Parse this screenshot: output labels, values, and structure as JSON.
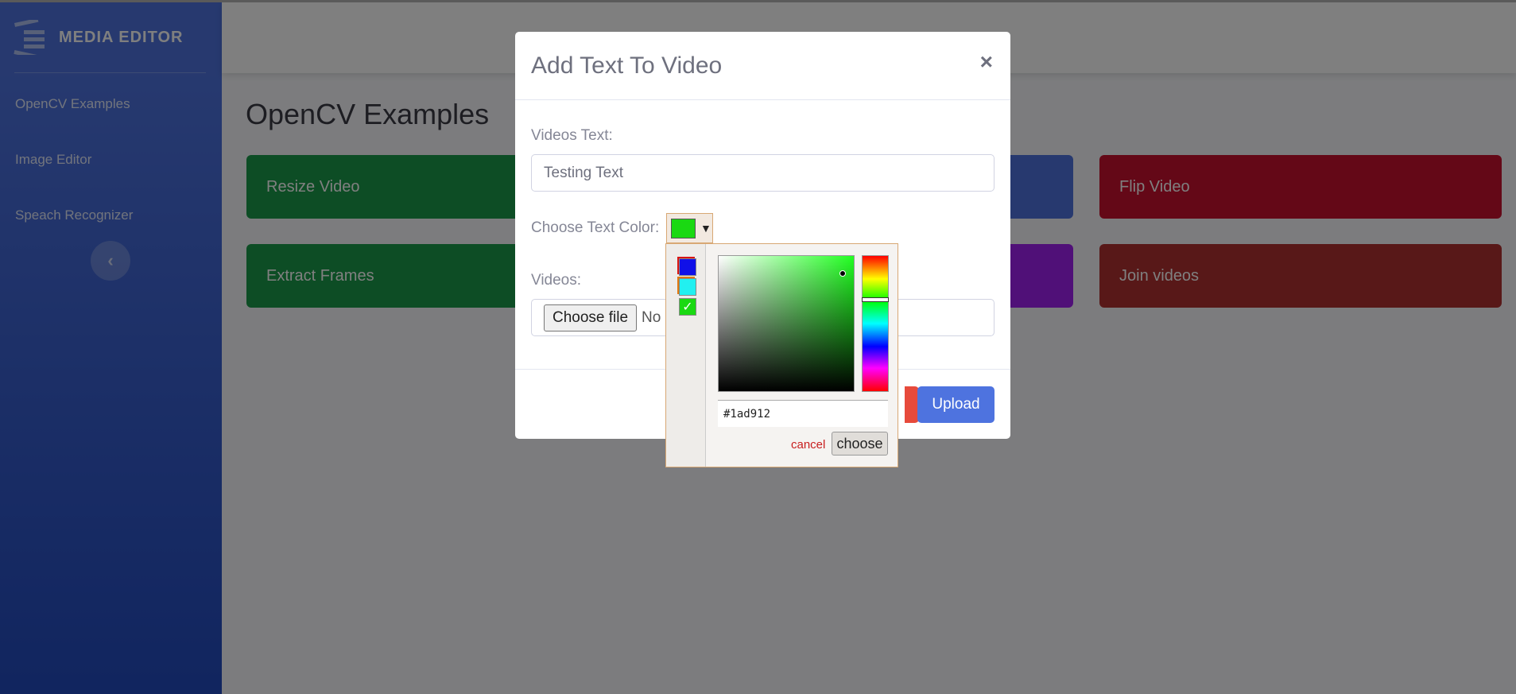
{
  "sidebar": {
    "brand": "MEDIA EDITOR",
    "nav": [
      "OpenCV Examples",
      "Image Editor",
      "Speach Recognizer"
    ],
    "toggle_glyph": "‹"
  },
  "main": {
    "title": "OpenCV Examples",
    "cards": [
      "Resize Video",
      "Extract Frames",
      "",
      "",
      "Flip Video",
      "Join videos"
    ]
  },
  "modal": {
    "title": "Add Text To Video",
    "close": "×",
    "text_label": "Videos Text:",
    "text_value": "Testing Text",
    "color_label": "Choose Text Color:",
    "videos_label": "Videos:",
    "file_button": "Choose file",
    "file_status": "No",
    "upload": "Upload",
    "selected_color": "#1ad912"
  },
  "picker": {
    "hex": "#1ad912",
    "cancel": "cancel",
    "choose": "choose",
    "recent_colors": [
      "#1010e8",
      "#22f0f0",
      "#1ad912"
    ]
  }
}
